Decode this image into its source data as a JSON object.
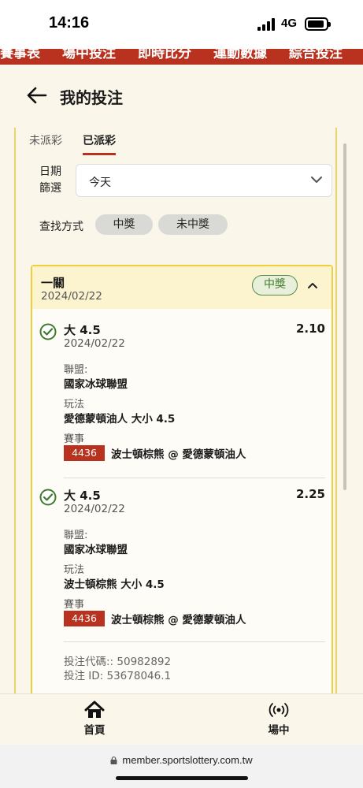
{
  "status_bar": {
    "time": "14:16",
    "network": "4G"
  },
  "top_nav": {
    "items": [
      "賽事表",
      "場中投注",
      "即時比分",
      "運動數據",
      "綜合投注"
    ]
  },
  "header": {
    "title": "我的投注"
  },
  "tabs": [
    {
      "label": "未派彩",
      "active": false
    },
    {
      "label": "已派彩",
      "active": true
    }
  ],
  "filter": {
    "date_label": "日期篩選",
    "date_value": "今天",
    "search_label": "查找方式",
    "chips": [
      "中獎",
      "未中獎"
    ]
  },
  "bet": {
    "type": "一關",
    "date": "2024/02/22",
    "status": "中獎",
    "selections": [
      {
        "name": "大 4.5",
        "odds": "2.10",
        "date": "2024/02/22",
        "league_label": "聯盟:",
        "league": "國家冰球聯盟",
        "market_label": "玩法",
        "market": "愛德蒙頓油人 大小 4.5",
        "match_label": "賽事",
        "match_no": "4436",
        "match": "波士頓棕熊 @ 愛德蒙頓油人"
      },
      {
        "name": "大 4.5",
        "odds": "2.25",
        "date": "2024/02/22",
        "league_label": "聯盟:",
        "league": "國家冰球聯盟",
        "market_label": "玩法",
        "market": "波士頓棕熊 大小 4.5",
        "match_label": "賽事",
        "match_no": "4436",
        "match": "波士頓棕熊 @ 愛德蒙頓油人"
      }
    ],
    "bet_code": "投注代碼:: 50982892",
    "bet_id": "投注 ID: 53678046.1"
  },
  "bottom_nav": [
    {
      "label": "首頁",
      "icon": "home-icon"
    },
    {
      "label": "場中",
      "icon": "live-broadcast-icon"
    }
  ],
  "browser": {
    "url": "member.sportslottery.com.tw"
  },
  "colors": {
    "brand_red": "#b8321f",
    "card_border": "#f1cf3a",
    "won_green": "#3f7a2c"
  }
}
